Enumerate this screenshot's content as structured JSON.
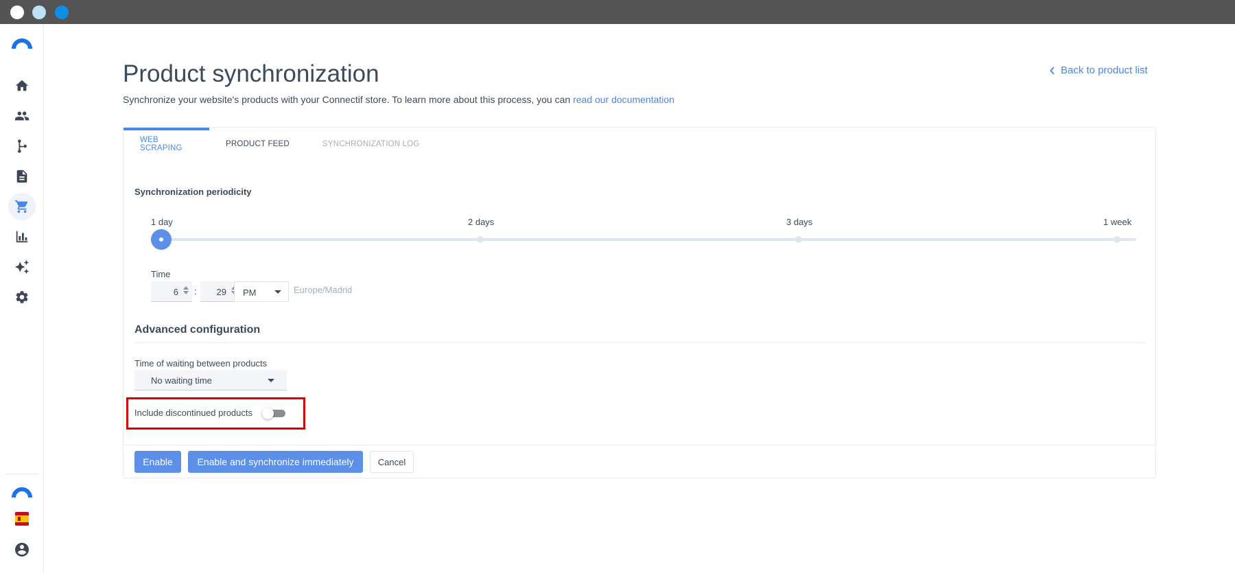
{
  "page": {
    "title": "Product synchronization",
    "subtitle_prefix": "Synchronize your website's products with your Connectif store. To learn more about this process, you can ",
    "subtitle_link": "read our documentation",
    "back_link": "Back to product list"
  },
  "sidebar": {
    "items": [
      {
        "icon": "home-icon"
      },
      {
        "icon": "people-icon"
      },
      {
        "icon": "workflow-icon"
      },
      {
        "icon": "document-icon"
      },
      {
        "icon": "cart-icon",
        "active": true
      },
      {
        "icon": "bar-chart-icon"
      },
      {
        "icon": "sparkle-icon"
      },
      {
        "icon": "gear-icon"
      }
    ],
    "bottom": [
      "connectif-logo-icon",
      "spain-flag-icon",
      "account-icon"
    ]
  },
  "tabs": [
    {
      "label": "WEB SCRAPING",
      "active": true
    },
    {
      "label": "PRODUCT FEED"
    },
    {
      "label": "SYNCHRONIZATION LOG"
    }
  ],
  "periodicity": {
    "label": "Synchronization periodicity",
    "options": [
      "1 day",
      "2 days",
      "3 days",
      "1 week"
    ],
    "selected_index": 0
  },
  "time": {
    "label": "Time",
    "hour": "6",
    "separator": ":",
    "minute": "29",
    "ampm": "PM",
    "timezone": "Europe/Madrid"
  },
  "advanced": {
    "title": "Advanced configuration",
    "wait_label": "Time of waiting between products",
    "wait_value": "No waiting time",
    "discontinued_label": "Include discontinued products",
    "discontinued_enabled": false
  },
  "buttons": {
    "enable": "Enable",
    "enable_sync": "Enable and synchronize immediately",
    "cancel": "Cancel"
  },
  "colors": {
    "accent": "#4a86e8",
    "primary_button": "#5b8fe8",
    "highlight": "#d70000"
  }
}
